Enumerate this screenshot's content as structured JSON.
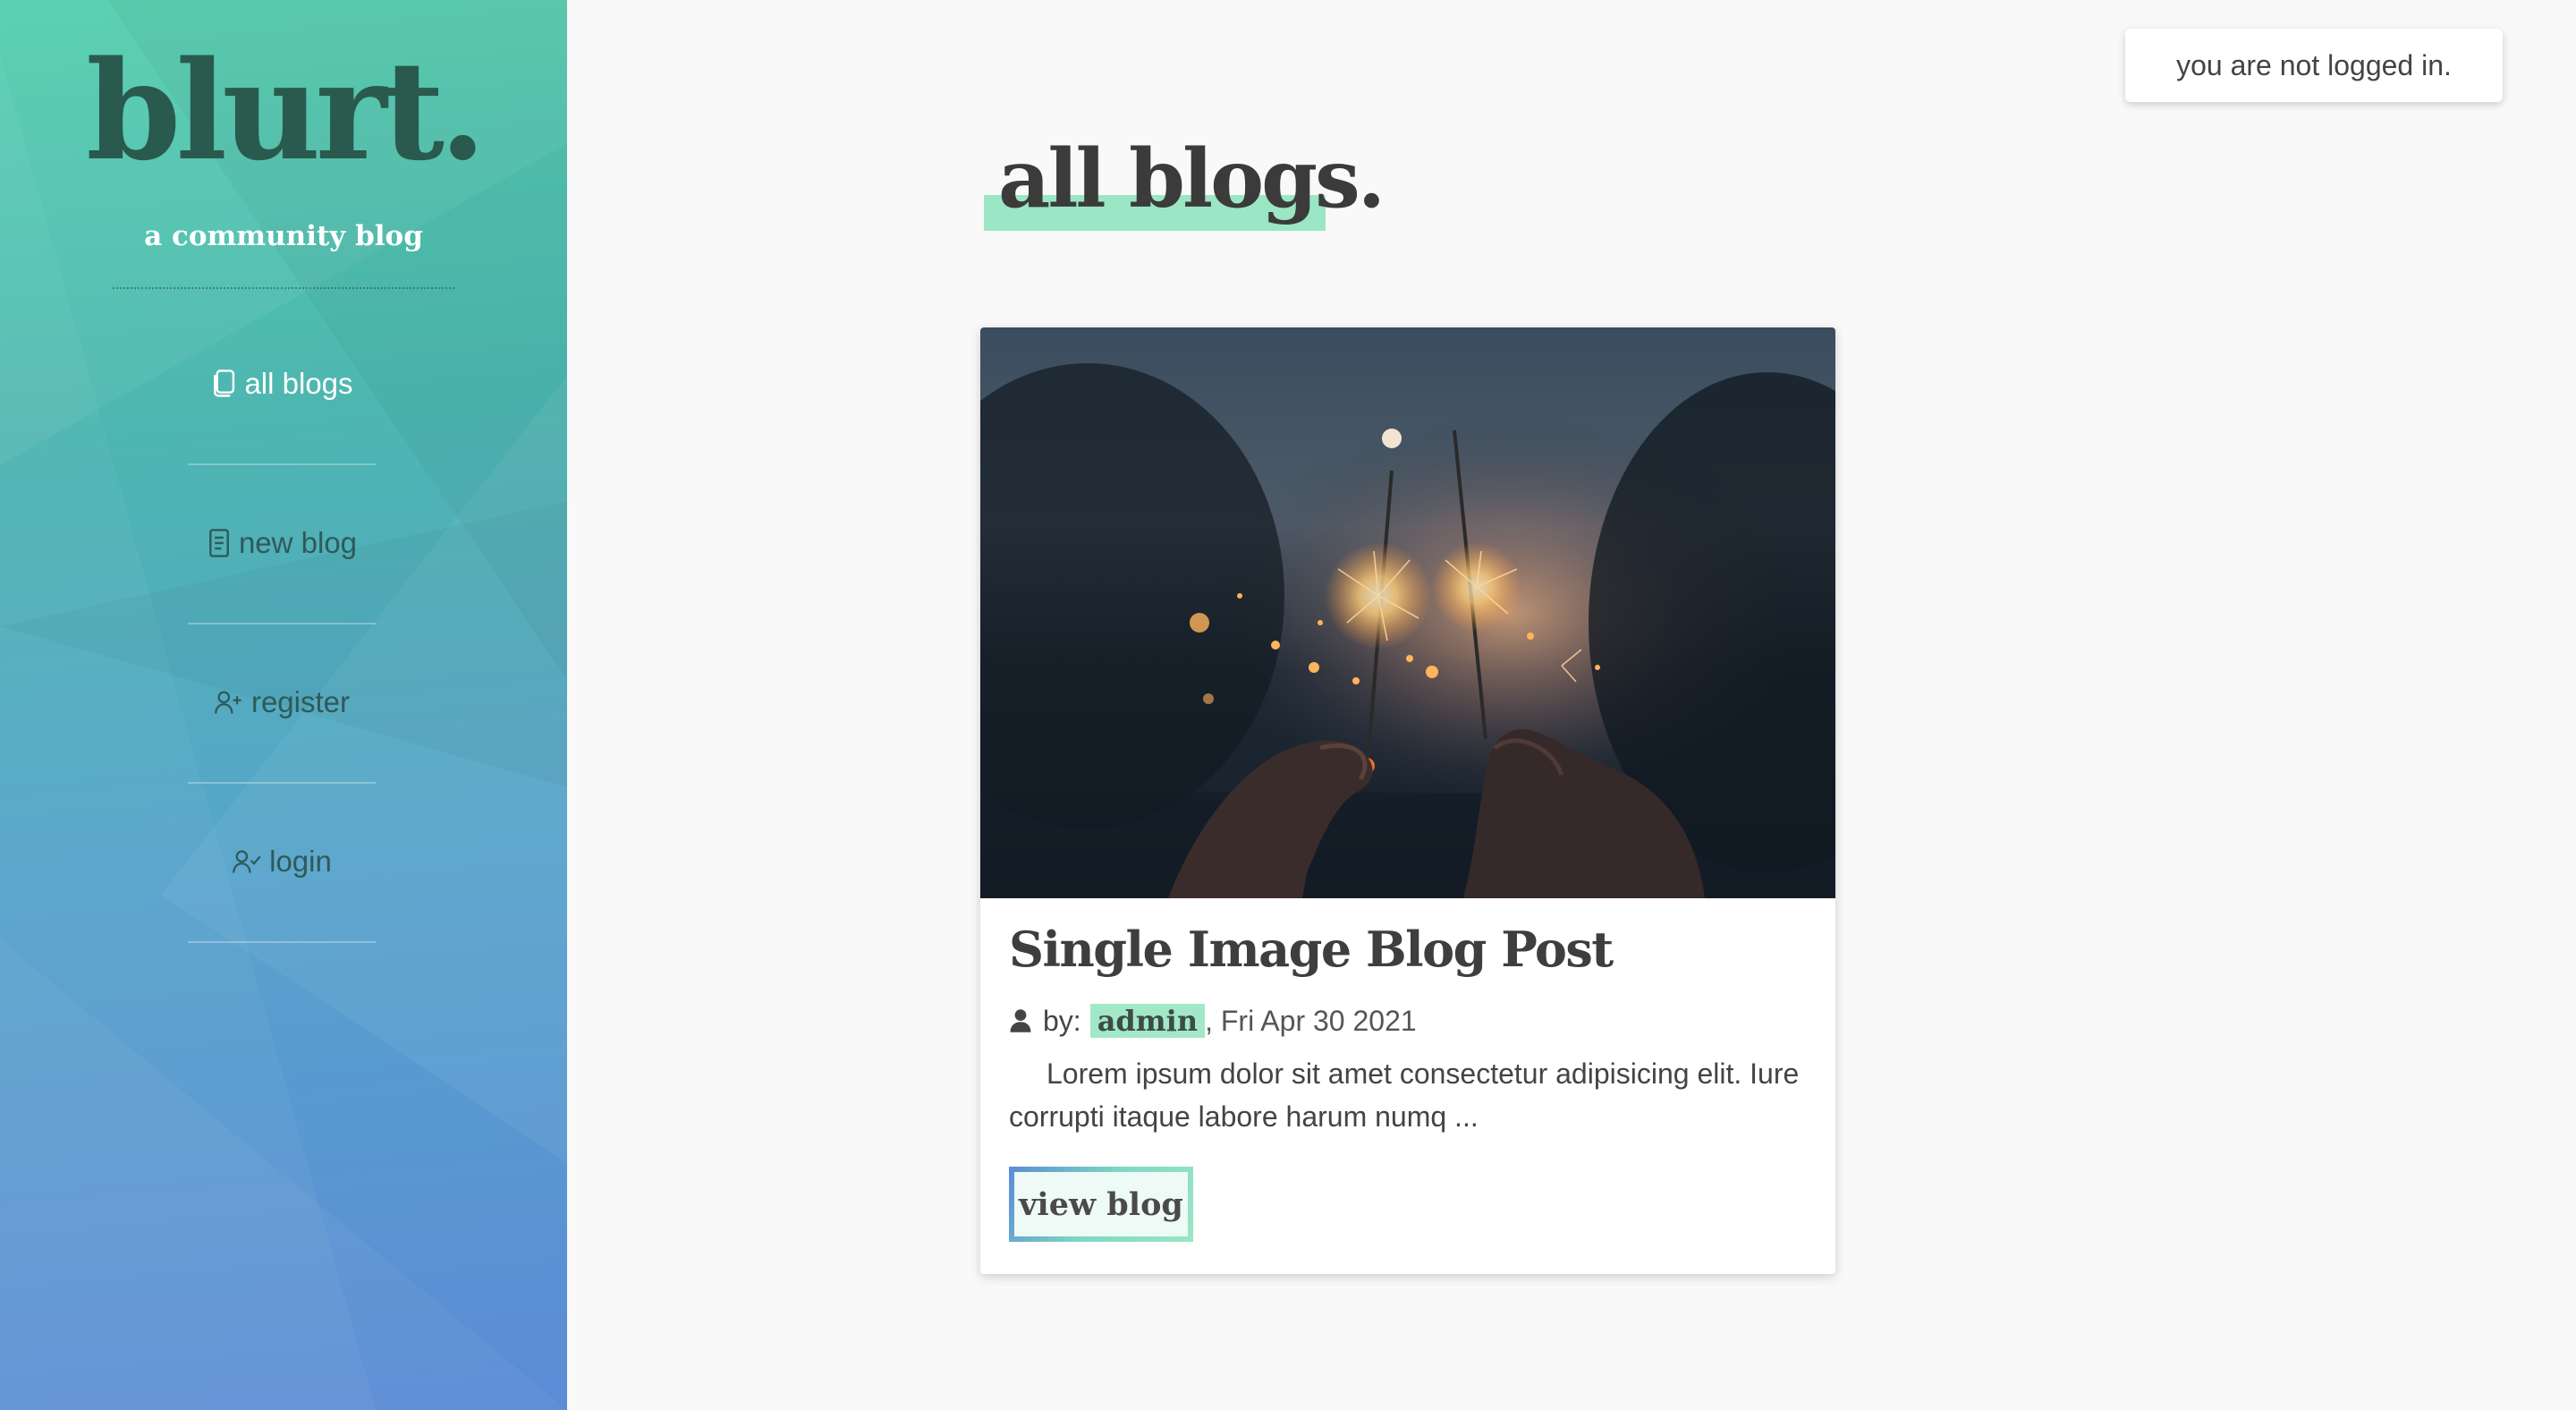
{
  "sidebar": {
    "brand": "blurt.",
    "tagline": "a community blog",
    "items": [
      {
        "label": "all blogs",
        "icon": "copy-icon",
        "active": true
      },
      {
        "label": "new blog",
        "icon": "file-text-icon",
        "active": false
      },
      {
        "label": "register",
        "icon": "user-plus-icon",
        "active": false
      },
      {
        "label": "login",
        "icon": "user-check-icon",
        "active": false
      }
    ]
  },
  "header": {
    "login_status": "you are not logged in."
  },
  "main": {
    "title": "all blogs.",
    "posts": [
      {
        "title": "Single Image Blog Post",
        "by_label": "by:",
        "author": "admin",
        "date": ", Fri Apr 30 2021",
        "excerpt": "Lorem ipsum dolor sit amet consectetur adipisicing elit. Iure corrupti itaque labore harum numq ...",
        "button_label": "view blog",
        "image": "sparklers-photo"
      }
    ]
  },
  "colors": {
    "sidebar_gradient": [
      "#54cfae",
      "#4db6b0",
      "#57a3cc",
      "#5b8bd6"
    ],
    "brand_text": "#2a5a4e",
    "highlight": "#9be6c4",
    "page_bg": "#f9f9f9"
  }
}
